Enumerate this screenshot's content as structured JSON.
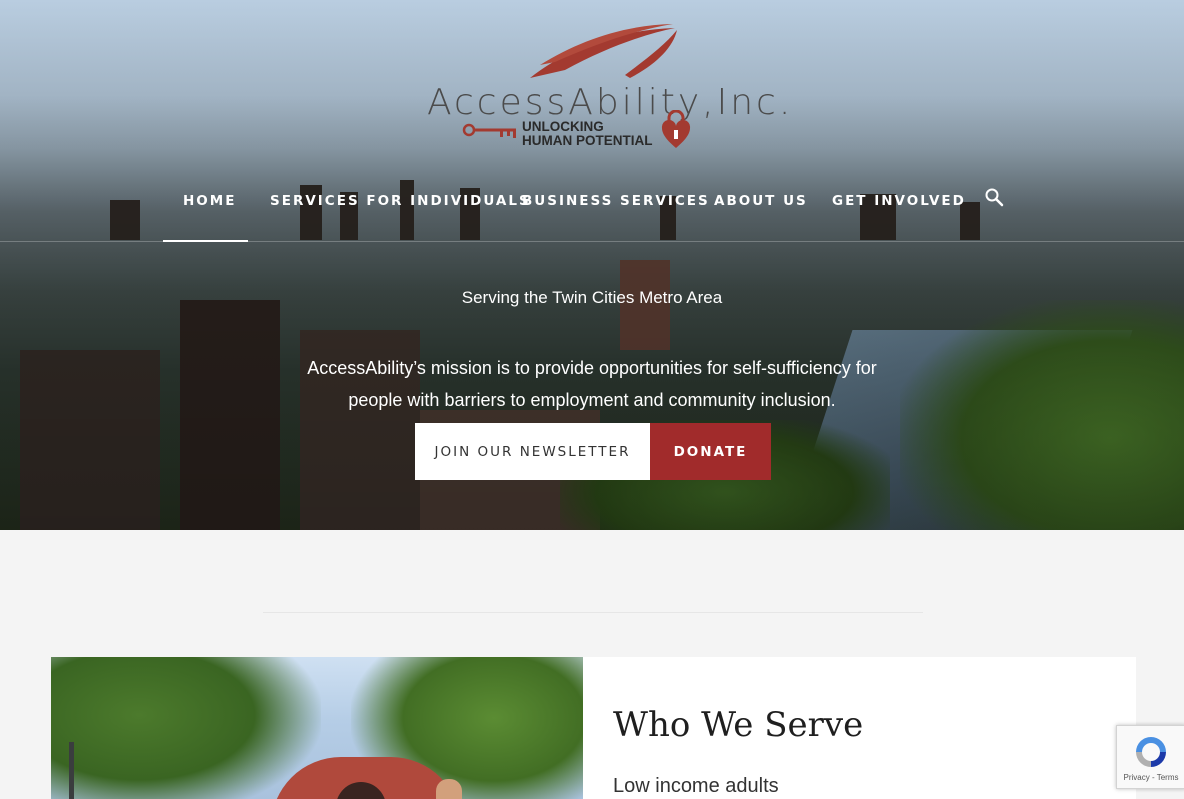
{
  "logo": {
    "name": "AccessAbility,Inc.",
    "tagline_line1": "UNLOCKING",
    "tagline_line2": "HUMAN POTENTIAL"
  },
  "nav": {
    "items": [
      {
        "label": "HOME",
        "active": true
      },
      {
        "label": "SERVICES FOR INDIVIDUALS"
      },
      {
        "label": "BUSINESS SERVICES"
      },
      {
        "label": "ABOUT US"
      },
      {
        "label": "GET INVOLVED"
      }
    ],
    "search_icon": "search-icon"
  },
  "hero": {
    "tagline": "Serving the Twin Cities Metro Area",
    "mission": "AccessAbility’s mission is to provide opportunities for self-sufficiency for people with barriers to employment and community inclusion.",
    "newsletter_button": "JOIN OUR NEWSLETTER",
    "donate_button": "DONATE"
  },
  "section": {
    "title": "Who We Serve",
    "first_item": "Low income adults"
  },
  "recaptcha": {
    "text": "Privacy - Terms"
  },
  "colors": {
    "brand_red": "#a12b2b",
    "nav_text": "#ffffff",
    "page_bg": "#f4f4f4"
  }
}
